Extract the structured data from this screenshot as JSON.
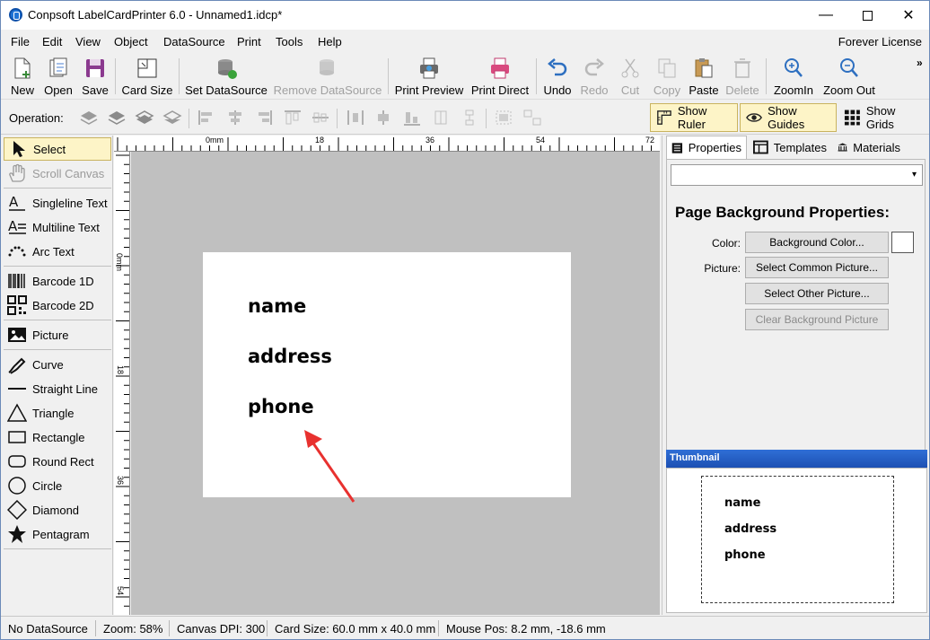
{
  "window": {
    "title": "Conpsoft LabelCardPrinter 6.0 - Unnamed1.idcp*",
    "minimize": "—",
    "close": "✕"
  },
  "menu": {
    "items": [
      "File",
      "Edit",
      "View",
      "Object",
      "DataSource",
      "Print",
      "Tools",
      "Help"
    ],
    "license": "Forever License"
  },
  "toolbar": {
    "new": "New",
    "open": "Open",
    "save": "Save",
    "card_size": "Card Size",
    "set_datasource": "Set DataSource",
    "remove_datasource": "Remove DataSource",
    "print_preview": "Print Preview",
    "print_direct": "Print Direct",
    "undo": "Undo",
    "redo": "Redo",
    "cut": "Cut",
    "copy": "Copy",
    "paste": "Paste",
    "delete": "Delete",
    "zoom_in": "ZoomIn",
    "zoom_out": "Zoom Out",
    "more": "»"
  },
  "operation": {
    "label": "Operation:",
    "show_ruler": "Show Ruler",
    "show_guides": "Show Guides",
    "show_grids": "Show Grids"
  },
  "tools": [
    {
      "label": "Select"
    },
    {
      "label": "Scroll Canvas"
    },
    {
      "label": "Singleline Text"
    },
    {
      "label": "Multiline Text"
    },
    {
      "label": "Arc Text"
    },
    {
      "label": "Barcode 1D"
    },
    {
      "label": "Barcode 2D"
    },
    {
      "label": "Picture"
    },
    {
      "label": "Curve"
    },
    {
      "label": "Straight Line"
    },
    {
      "label": "Triangle"
    },
    {
      "label": "Rectangle"
    },
    {
      "label": "Round Rect"
    },
    {
      "label": "Circle"
    },
    {
      "label": "Diamond"
    },
    {
      "label": "Pentagram"
    }
  ],
  "ruler": {
    "h_labels": [
      "0mm",
      "18",
      "36",
      "54",
      "72"
    ],
    "v_labels": [
      "0mm",
      "18",
      "36",
      "54"
    ]
  },
  "card": {
    "fields": [
      "name",
      "address",
      "phone"
    ]
  },
  "panel": {
    "tabs": {
      "properties": "Properties",
      "templates": "Templates",
      "materials": "Materials"
    },
    "section_title": "Page Background Properties:",
    "color_label": "Color:",
    "picture_label": "Picture:",
    "bg_color_button": "Background Color...",
    "common_picture_button": "Select Common Picture...",
    "other_picture_button": "Select Other Picture...",
    "clear_button": "Clear Background Picture",
    "thumbnail": "Thumbnail"
  },
  "status": {
    "datasource": "No DataSource",
    "zoom": "Zoom: 58%",
    "dpi": "Canvas DPI: 300",
    "card_size": "Card Size: 60.0 mm x 40.0 mm",
    "mouse_pos": "Mouse Pos: 8.2 mm, -18.6 mm"
  },
  "colors": {
    "accent": "#1f74d6",
    "active_tool": "#fdf4c7",
    "annotation_arrow": "#e8312f",
    "thumbnail_header": "#2f6fd6"
  }
}
